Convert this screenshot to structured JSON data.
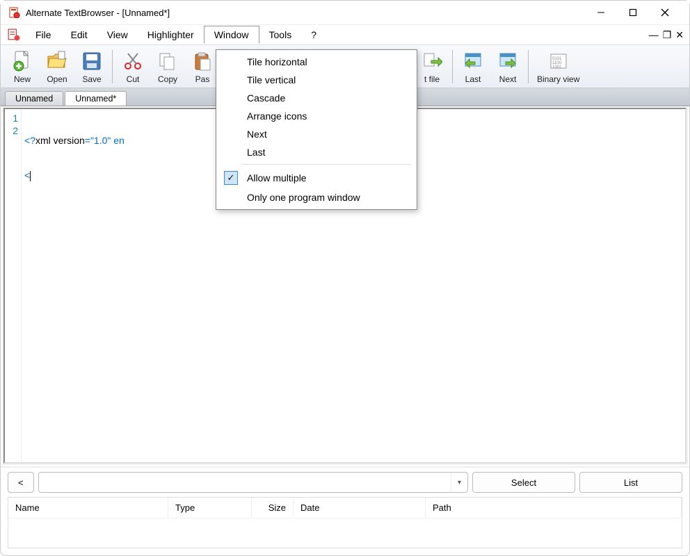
{
  "window": {
    "title": "Alternate TextBrowser - [Unnamed*]"
  },
  "menubar": {
    "file": "File",
    "edit": "Edit",
    "view": "View",
    "highlighter": "Highlighter",
    "window": "Window",
    "tools": "Tools",
    "help": "?"
  },
  "window_menu": {
    "tile_horizontal": "Tile horizontal",
    "tile_vertical": "Tile vertical",
    "cascade": "Cascade",
    "arrange_icons": "Arrange icons",
    "next": "Next",
    "last": "Last",
    "allow_multiple": "Allow multiple",
    "only_one": "Only one program window"
  },
  "toolbar": {
    "new": "New",
    "open": "Open",
    "save": "Save",
    "cut": "Cut",
    "copy": "Copy",
    "paste": "Pas",
    "nextfile": "t file",
    "last": "Last",
    "next": "Next",
    "binary": "Binary view"
  },
  "tabs": {
    "tab1": "Unnamed",
    "tab2": "Unnamed*"
  },
  "editor": {
    "line_numbers": [
      "1",
      "2"
    ],
    "line1_a": "<?",
    "line1_b": "xml version",
    "line1_c": "=\"1.0\" en",
    "line2": "<"
  },
  "bottom": {
    "lt": "<",
    "select": "Select",
    "list": "List",
    "cols": {
      "name": "Name",
      "type": "Type",
      "size": "Size",
      "date": "Date",
      "path": "Path"
    }
  }
}
